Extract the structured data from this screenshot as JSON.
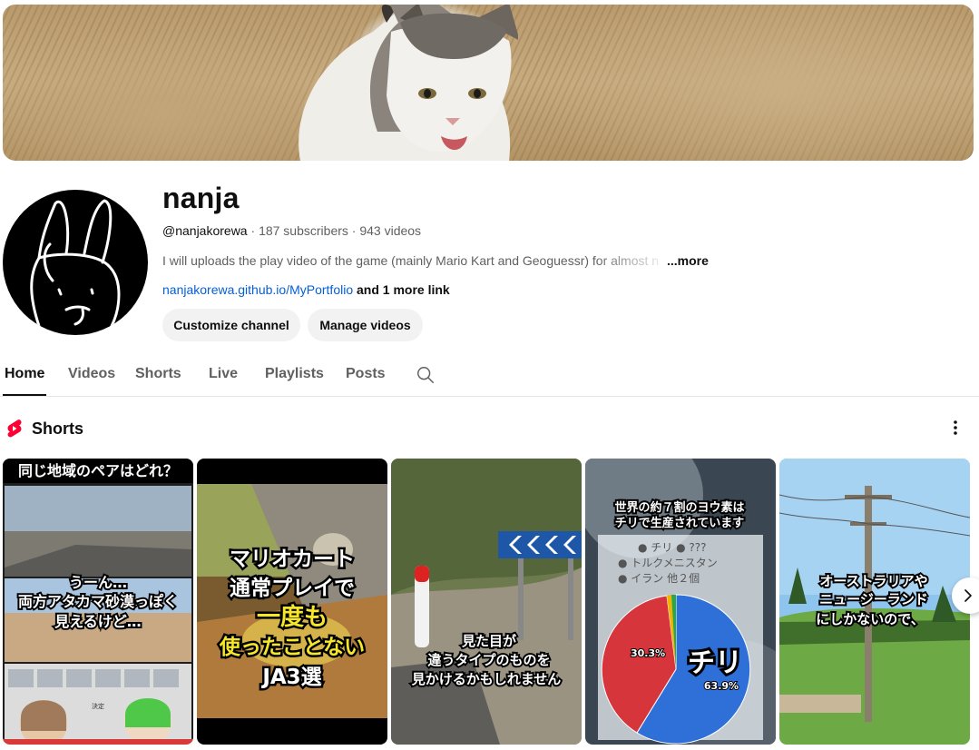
{
  "channel": {
    "name": "nanja",
    "handle": "@nanjakorewa",
    "sep1": " · ",
    "subscribers": "187 subscribers",
    "sep2": " · ",
    "videos": "943 videos",
    "description": "I will  uploads the play video of the game (mainly Mario Kart and Geoguessr) for almost n",
    "more": "...more",
    "link": "nanjakorewa.github.io/MyPortfolio",
    "more_links": " and 1 more link"
  },
  "buttons": {
    "customize": "Customize channel",
    "manage": "Manage videos"
  },
  "tabs": [
    {
      "label": "Home"
    },
    {
      "label": "Videos"
    },
    {
      "label": "Shorts"
    },
    {
      "label": "Live"
    },
    {
      "label": "Playlists"
    },
    {
      "label": "Posts"
    }
  ],
  "shorts_section": {
    "title": "Shorts"
  },
  "shorts": [
    {
      "lines": [
        "同じ地域のペアはどれ？",
        "うーん…",
        "両方アタカマ砂漠っぽく",
        "見えるけど…",
        "決定"
      ]
    },
    {
      "lines": [
        "マリオカート",
        "通常プレイで",
        "一度も",
        "使ったことない",
        "JA3選"
      ]
    },
    {
      "lines": [
        "見た目が",
        "違うタイプのものを",
        "見かけるかもしれません"
      ]
    },
    {
      "lines": [
        "世界の約７割のヨウ素は",
        "チリで生産されています",
        "● チリ ● ???",
        "● トルクメニスタン",
        "● イラン 他２個",
        "30.3%",
        "チリ",
        "63.9%"
      ]
    },
    {
      "lines": [
        "オーストラリアや",
        "ニュージーランド",
        "にしかないので、"
      ]
    }
  ],
  "icons": {
    "search": "search-icon",
    "more": "more-vert-icon",
    "shorts": "shorts-logo-icon",
    "next": "chevron-right-icon"
  },
  "colors": {
    "link": "#065fd4",
    "shorts_red": "#ff0033",
    "yellow_text": "#f5e62a"
  }
}
